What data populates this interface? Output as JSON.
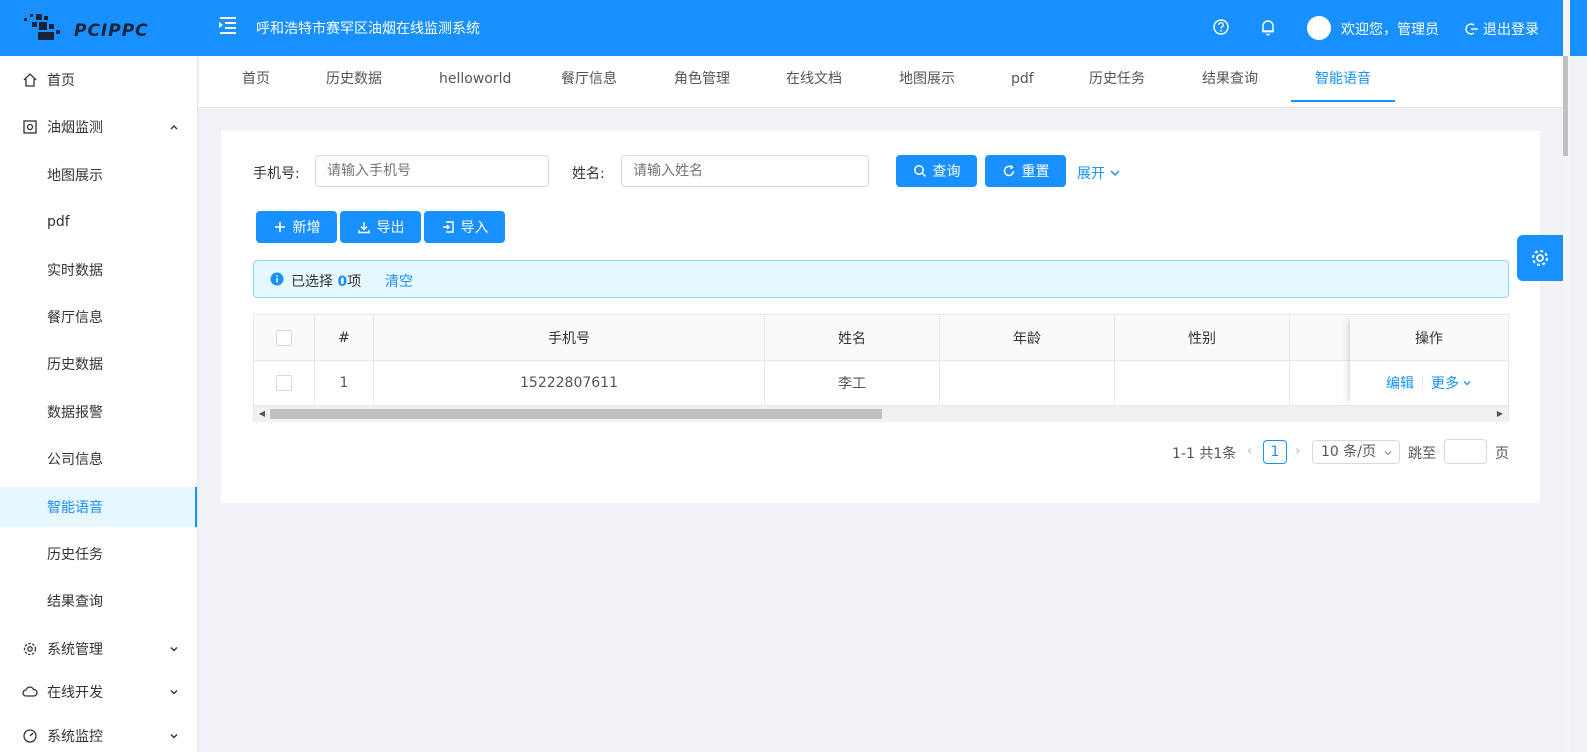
{
  "header": {
    "logo_text": "PCIPPC",
    "title": "呼和浩特市赛罕区油烟在线监测系统",
    "welcome": "欢迎您，管理员",
    "logout": "退出登录",
    "icons": [
      "menu-fold-icon",
      "help-icon",
      "bell-icon",
      "logout-icon"
    ]
  },
  "sidebar": {
    "items": [
      {
        "label": "首页",
        "icon": "home-icon"
      },
      {
        "label": "油烟监测",
        "icon": "monitor-icon",
        "expanded": true
      },
      {
        "label": "地图展示"
      },
      {
        "label": "pdf"
      },
      {
        "label": "实时数据"
      },
      {
        "label": "餐厅信息"
      },
      {
        "label": "历史数据"
      },
      {
        "label": "数据报警"
      },
      {
        "label": "公司信息"
      },
      {
        "label": "智能语音",
        "active": true
      },
      {
        "label": "历史任务"
      },
      {
        "label": "结果查询"
      },
      {
        "label": "系统管理",
        "icon": "gear-icon"
      },
      {
        "label": "在线开发",
        "icon": "cloud-icon"
      },
      {
        "label": "系统监控",
        "icon": "dashboard-icon"
      }
    ]
  },
  "tabs": [
    "首页",
    "历史数据",
    "helloworld",
    "餐厅信息",
    "角色管理",
    "在线文档",
    "地图展示",
    "pdf",
    "历史任务",
    "结果查询",
    "智能语音"
  ],
  "active_tab": "智能语音",
  "search": {
    "phone_label": "手机号:",
    "phone_placeholder": "请输入手机号",
    "name_label": "姓名:",
    "name_placeholder": "请输入姓名",
    "query": "查询",
    "reset": "重置",
    "expand": "展开"
  },
  "toolbar": {
    "add": "新增",
    "export": "导出",
    "import": "导入"
  },
  "alert": {
    "prefix": "已选择",
    "count": "0",
    "suffix": "项",
    "clear": "清空"
  },
  "table": {
    "columns": [
      "#",
      "手机号",
      "姓名",
      "年龄",
      "性别",
      "操作"
    ],
    "rows": [
      {
        "index": "1",
        "phone": "15222807611",
        "name": "李工",
        "age": "",
        "gender": "",
        "edit": "编辑",
        "more": "更多"
      }
    ]
  },
  "pagination": {
    "total": "1-1 共1条",
    "current": "1",
    "page_size": "10 条/页",
    "jump": "跳至",
    "page": "页"
  },
  "colors": {
    "primary": "#1890ff",
    "active_bg": "#e6f7ff"
  }
}
